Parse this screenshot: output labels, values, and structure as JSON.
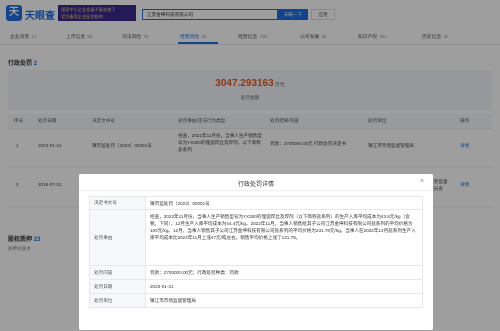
{
  "header": {
    "logo_mark": "天",
    "logo_text": "天眼查",
    "banner_line1": "国家中小企业发展子基金旗下",
    "banner_line2": "官方备案企业征信机构",
    "search_value": "江苏金坤科技有限公司",
    "search_button": "天眼一下",
    "secondary_button": "应用"
  },
  "tabs": [
    {
      "label": "企业背景",
      "count": "17"
    },
    {
      "label": "上市信息",
      "count": "55"
    },
    {
      "label": "司法风险",
      "count": "76"
    },
    {
      "label": "经营风险",
      "count": "25"
    },
    {
      "label": "经营信息",
      "count": "700"
    },
    {
      "label": "公司发展",
      "count": "45"
    },
    {
      "label": "知识产权",
      "count": "99+"
    },
    {
      "label": "历史信息",
      "count": "40"
    }
  ],
  "section": {
    "title": "行政处罚",
    "count": "2",
    "subtitle": "",
    "right_link": "",
    "amount": "3047.293163",
    "amount_unit": "万元",
    "amount_label": "处罚金额"
  },
  "table": {
    "headers": [
      "序号",
      "处罚日期",
      "决定文书号",
      "处罚事由/违法行为类型",
      "处罚结果/内容",
      "处罚单位",
      "操作"
    ],
    "rows": [
      {
        "index": "1",
        "date": "2023-01-31",
        "doc_no": "镇市监处罚〔2023〕00001号",
        "reason": "经查，2022年11月份，当事人生产销售型号为YX300的埋弧焊丝及焊剂，以下简称盐系列",
        "result": "罚款：2700000.00元 行政处罚决定书",
        "unit": "镇江市市场监督管理局",
        "action": "详情"
      },
      {
        "index": "2",
        "date": "2018-07-31",
        "doc_no": "",
        "reason": "",
        "result": "",
        "unit": "中国证券监督管理委员会",
        "action": "详情"
      }
    ]
  },
  "section2": {
    "title": "股权质押",
    "count": "23",
    "subtitle": "质押总股本"
  },
  "modal": {
    "title": "行政处罚详情",
    "close_icon": "×",
    "rows": [
      {
        "label": "决定书文号",
        "value": "镇市监处罚〔2023〕00001号"
      },
      {
        "label": "处罚事由",
        "value": "经查，2022年11月份，当事人生产销售型号为YX300的埋弧焊丝及焊剂（以下简称盐系列）的生产入库平均成本为43.6元/kg（含税，下同），12月生产入库平均成本为44.4元/kg。2022年11月，当事人销售给其子公司江苏金坤科技有限公司盐系列的平均价格为100元/kg。12月，当事人销售其子公司江苏金坤科技有限公司盐系列的平均价格为231.78元/kg。当事人在2022年12月盐系列生产入库平均成本比2022年11月上涨47元/吨左右，销售平均价格上涨了131.78。"
      },
      {
        "label": "处罚内容",
        "value": "罚款：2700000.00元；行政处罚种类：罚款"
      },
      {
        "label": "处罚日期",
        "value": "2023-01-31"
      },
      {
        "label": "处罚单位",
        "value": "镇江市市场监督管理局"
      }
    ]
  },
  "colors": {
    "accent": "#1e6ee6",
    "amount": "#e8591c"
  }
}
